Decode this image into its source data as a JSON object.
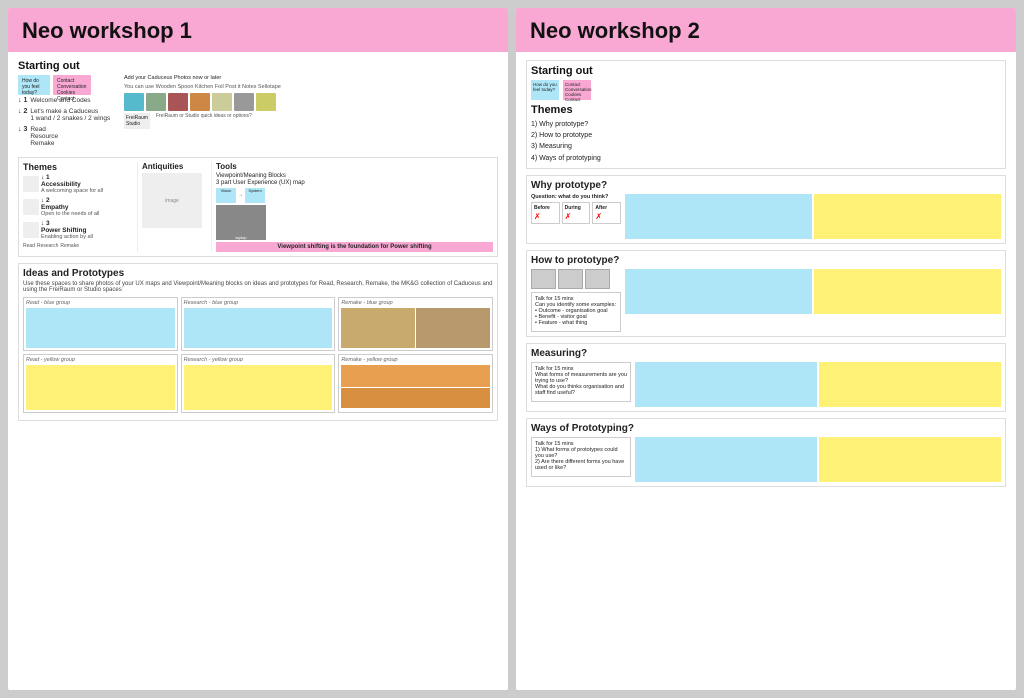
{
  "workshops": [
    {
      "id": "workshop1",
      "title": "Neo workshop 1",
      "header_color": "#f9a8d4",
      "starting_out": {
        "label": "Starting out",
        "steps": [
          {
            "num": "1",
            "text": "Welcome and Codes"
          },
          {
            "num": "2",
            "text": "Let's make a Caduceus\n1 wand\n2 snakes\n2 wings"
          },
          {
            "num": "3",
            "text": "Read\nResource\nRemake"
          }
        ],
        "sticky_texts": [
          "How do you feel today?",
          "Contact\nConversation\nCookies Contact"
        ],
        "caption": "Add your Caduceus Photos now or later",
        "wooden_spoon_text": "You can use Wooden Spoon Kitchen Foil Post it Notes Sellotape",
        "freiraum": "FreiRaum Studio",
        "freiraum_sub": "FreiRaum or Studio quick ideas or options?"
      },
      "themes": {
        "label": "Themes",
        "items": [
          {
            "num": "1",
            "name": "Accessibility",
            "desc": "A welcoming space for all"
          },
          {
            "num": "2",
            "name": "Empathy",
            "desc": "Open to the needs of all"
          },
          {
            "num": "3",
            "name": "Power Shifting",
            "desc": "Enabling action by all"
          }
        ],
        "sub_labels": [
          "Read",
          "Research",
          "Remake"
        ]
      },
      "antiquities": {
        "label": "Antiquities"
      },
      "tools": {
        "label": "Tools",
        "desc1": "Viewpoint/Meaning Blocks",
        "desc2": "3 part User Experience (UX) map",
        "desc3": "Vision → System ↑",
        "highlight": "Viewpoint shifting is the foundation for Power shifting",
        "visitor_label": "Visitor",
        "system_label": "System"
      },
      "ideas": {
        "label": "Ideas and Prototypes",
        "desc": "Use these spaces to share photos of your UX maps and Viewpoint/Meaning blocks on ideas and prototypes for Read, Research, Remake, the MK&G collection of Caduceus and using the FreiRaum or Studio spaces",
        "groups": [
          {
            "rows": [
              {
                "label": "Read - blue group",
                "has_photo": false,
                "photo_color": ""
              },
              {
                "label": "Research - blue group",
                "has_photo": false,
                "photo_color": ""
              },
              {
                "label": "Remake - blue group",
                "has_photo": true,
                "photo_color": "#c8a96e"
              }
            ]
          },
          {
            "rows": [
              {
                "label": "Read - yellow group",
                "has_photo": false,
                "photo_color": ""
              },
              {
                "label": "Research - yellow group",
                "has_photo": false,
                "photo_color": ""
              },
              {
                "label": "Remake - yellow group",
                "has_photo": true,
                "photo_color": "#e8a050"
              }
            ]
          }
        ]
      }
    },
    {
      "id": "workshop2",
      "title": "Neo workshop 2",
      "header_color": "#f9a8d4",
      "starting_out": {
        "label": "Starting out",
        "sticky_blue": "How do you feel today?",
        "sticky_pink": "Contact Conversation Cookies Contact"
      },
      "themes": {
        "label": "Themes",
        "items": [
          "1) Why prototype?",
          "2) How to prototype",
          "3) Measuring",
          "4) Ways of prototyping"
        ]
      },
      "sections": [
        {
          "title": "Why prototype?",
          "talk_text": "",
          "has_bda": true,
          "bda_label": "Question: what do you think?",
          "bda_cols": [
            "Before",
            "During",
            "After"
          ],
          "sticky_colors": [
            "blue",
            "yellow"
          ]
        },
        {
          "title": "How to prototype?",
          "talk_text": "Talk for 15 mins\nCan you identify some examples:\n• Outcome - organisation goal\n• Benefit - visitor goal\n• Feature - what thing",
          "has_images": true,
          "sticky_colors": [
            "blue",
            "yellow"
          ]
        },
        {
          "title": "Measuring?",
          "talk_text": "Talk for 15 mins\nWhat forms of measurements are you trying to use?\nWhat do you thinks organisation and staff find useful?",
          "sticky_colors": [
            "blue",
            "yellow"
          ]
        },
        {
          "title": "Ways of Prototyping?",
          "talk_text": "Talk for 15 mins\n1) What forms of prototypes could you use?\n2) Are there different forms you have used or like?",
          "sticky_colors": [
            "blue",
            "yellow"
          ]
        }
      ]
    }
  ]
}
